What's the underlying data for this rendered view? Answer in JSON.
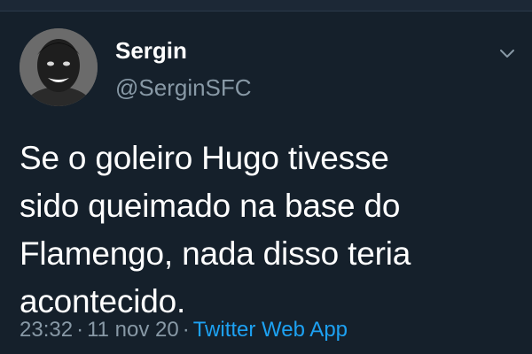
{
  "tweet": {
    "author": {
      "display_name": "Sergin",
      "handle": "@SerginSFC"
    },
    "text_lines": [
      "Se o goleiro Hugo tivesse",
      "sido queimado na base do",
      "Flamengo, nada disso teria",
      "acontecido."
    ],
    "time": "23:32",
    "date": "11 nov 20",
    "separator": "·",
    "source": "Twitter Web App"
  },
  "icons": {
    "menu": "chevron-down-icon",
    "avatar": "profile-photo"
  },
  "colors": {
    "background": "#15202b",
    "text": "#ffffff",
    "secondary": "#8899a6",
    "link": "#1da1f2"
  }
}
